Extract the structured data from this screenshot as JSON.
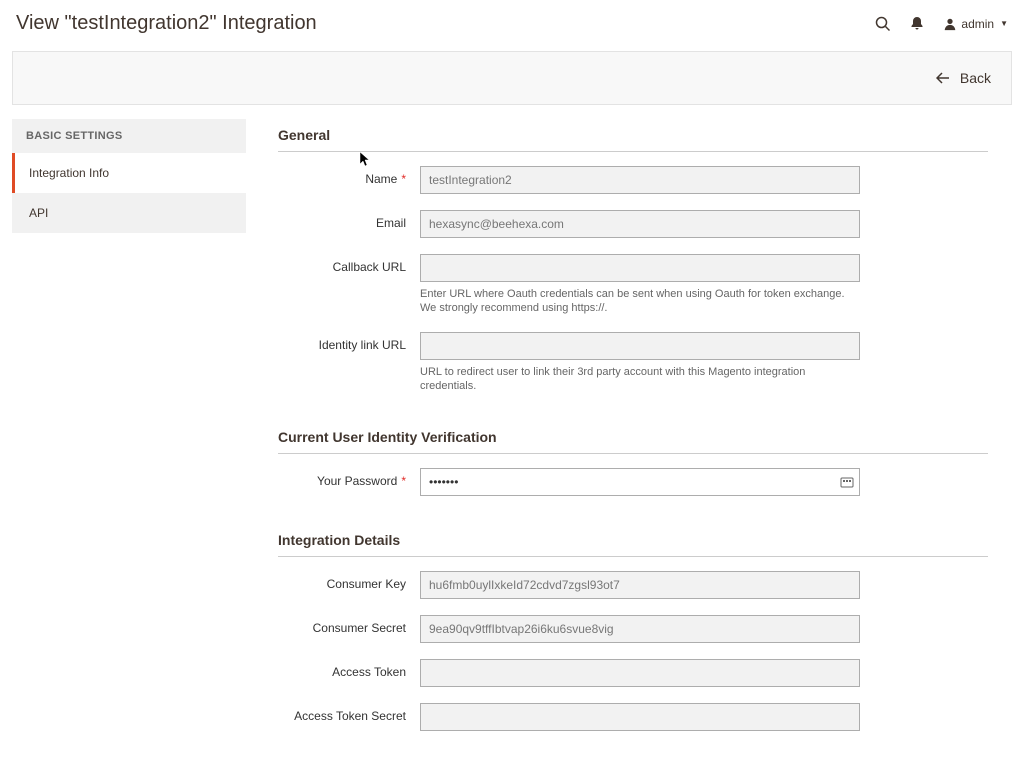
{
  "header": {
    "title": "View \"testIntegration2\" Integration",
    "user": "admin"
  },
  "actionBar": {
    "back": "Back"
  },
  "sidebar": {
    "header": "BASIC SETTINGS",
    "items": [
      {
        "label": "Integration Info"
      },
      {
        "label": "API"
      }
    ]
  },
  "sections": {
    "general": {
      "title": "General",
      "fields": {
        "name": {
          "label": "Name",
          "value": "testIntegration2"
        },
        "email": {
          "label": "Email",
          "value": "hexasync@beehexa.com"
        },
        "callback": {
          "label": "Callback URL",
          "value": "",
          "hint": "Enter URL where Oauth credentials can be sent when using Oauth for token exchange. We strongly recommend using https://."
        },
        "identity": {
          "label": "Identity link URL",
          "value": "",
          "hint": "URL to redirect user to link their 3rd party account with this Magento integration credentials."
        }
      }
    },
    "verification": {
      "title": "Current User Identity Verification",
      "fields": {
        "password": {
          "label": "Your Password",
          "value": "•••••••"
        }
      }
    },
    "details": {
      "title": "Integration Details",
      "fields": {
        "consumerKey": {
          "label": "Consumer Key",
          "value": "hu6fmb0uylIxkeId72cdvd7zgsl93ot7"
        },
        "consumerSecret": {
          "label": "Consumer Secret",
          "value": "9ea90qv9tffIbtvap26i6ku6svue8vig"
        },
        "accessToken": {
          "label": "Access Token",
          "value": ""
        },
        "accessTokenSecret": {
          "label": "Access Token Secret",
          "value": ""
        }
      }
    }
  }
}
